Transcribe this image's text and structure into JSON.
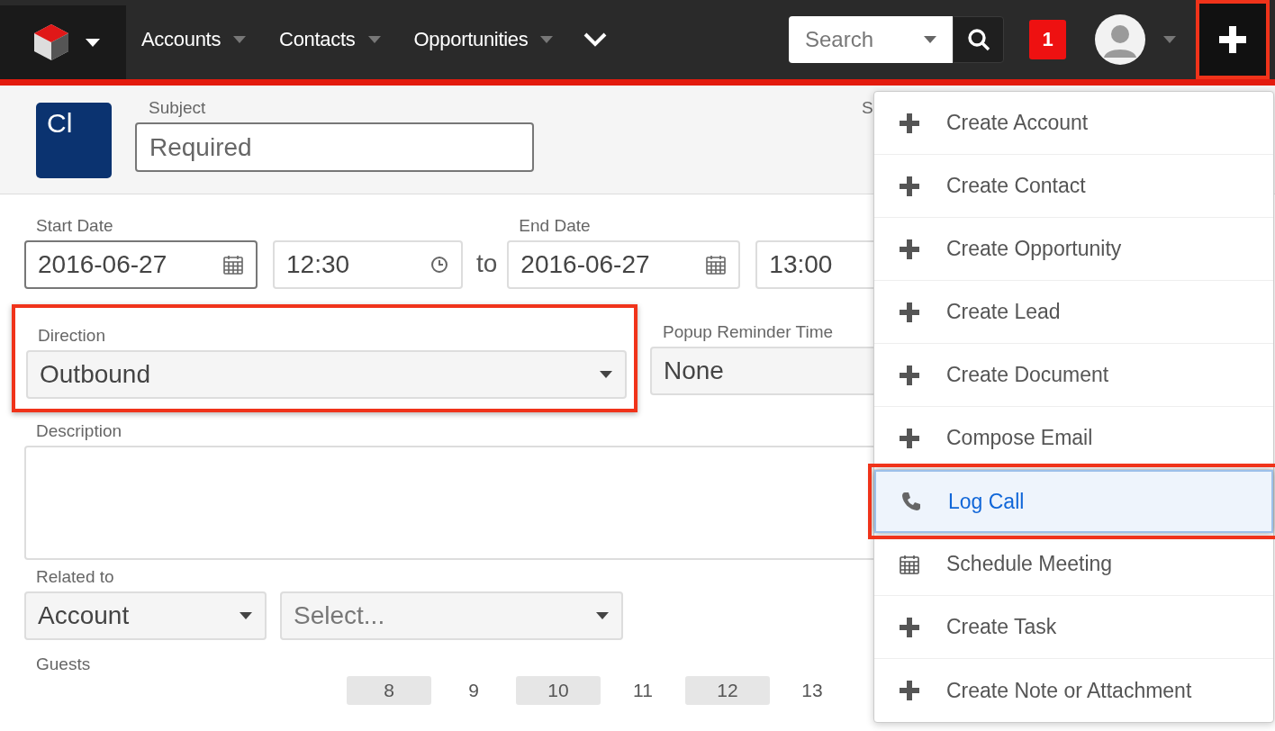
{
  "navbar": {
    "nav_items": [
      {
        "label": "Accounts"
      },
      {
        "label": "Contacts"
      },
      {
        "label": "Opportunities"
      }
    ],
    "search": {
      "placeholder": "Search"
    },
    "notification_count": "1",
    "quick_create": {
      "highlighted": true
    }
  },
  "record_header": {
    "module_badge": "Cl",
    "subject": {
      "label": "Subject",
      "placeholder": "Required"
    },
    "status": {
      "label": "S"
    }
  },
  "form": {
    "start_date": {
      "label": "Start Date",
      "value": "2016-06-27"
    },
    "start_time": {
      "value": "12:30"
    },
    "to": "to",
    "end_date": {
      "label": "End Date",
      "value": "2016-06-27"
    },
    "end_time": {
      "value": "13:00"
    },
    "direction": {
      "label": "Direction",
      "value": "Outbound",
      "highlighted": true
    },
    "popup_reminder": {
      "label": "Popup Reminder Time",
      "value": "None"
    },
    "description": {
      "label": "Description"
    },
    "related_to": {
      "label": "Related to",
      "module": "Account",
      "record_placeholder": "Select..."
    },
    "guests": {
      "label": "Guests",
      "hours": [
        {
          "label": "8",
          "shaded": true
        },
        {
          "label": "9",
          "shaded": false
        },
        {
          "label": "10",
          "shaded": true
        },
        {
          "label": "11",
          "shaded": false
        },
        {
          "label": "12",
          "shaded": true
        },
        {
          "label": "13",
          "shaded": false
        }
      ]
    }
  },
  "quick_create_menu": [
    {
      "label": "Create Account",
      "kind": "plus",
      "selected": false,
      "highlighted": false
    },
    {
      "label": "Create Contact",
      "kind": "plus",
      "selected": false,
      "highlighted": false
    },
    {
      "label": "Create Opportunity",
      "kind": "plus",
      "selected": false,
      "highlighted": false
    },
    {
      "label": "Create Lead",
      "kind": "plus",
      "selected": false,
      "highlighted": false
    },
    {
      "label": "Create Document",
      "kind": "plus",
      "selected": false,
      "highlighted": false
    },
    {
      "label": "Compose Email",
      "kind": "plus",
      "selected": false,
      "highlighted": false
    },
    {
      "label": "Log Call",
      "kind": "phone",
      "selected": true,
      "highlighted": true
    },
    {
      "label": "Schedule Meeting",
      "kind": "calendar",
      "selected": false,
      "highlighted": false
    },
    {
      "label": "Create Task",
      "kind": "plus",
      "selected": false,
      "highlighted": false
    },
    {
      "label": "Create Note or Attachment",
      "kind": "plus",
      "selected": false,
      "highlighted": false
    }
  ]
}
